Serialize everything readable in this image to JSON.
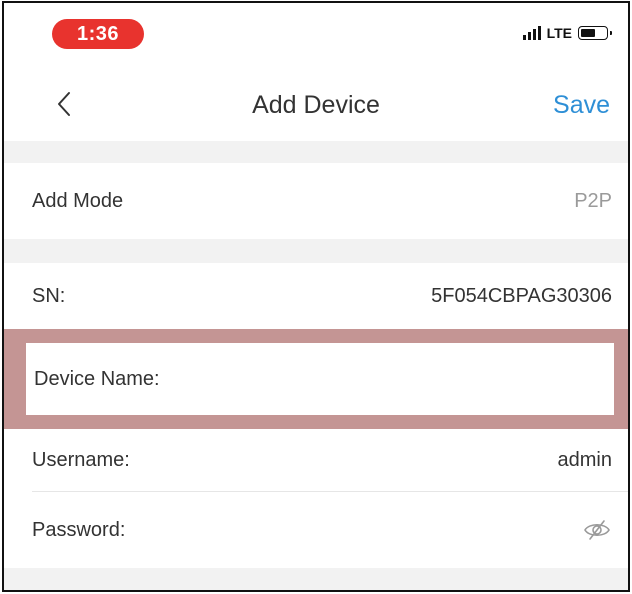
{
  "status_bar": {
    "time": "1:36",
    "network": "LTE"
  },
  "nav": {
    "title": "Add Device",
    "save_label": "Save"
  },
  "form": {
    "add_mode": {
      "label": "Add Mode",
      "value": "P2P"
    },
    "sn": {
      "label": "SN:",
      "value": "5F054CBPAG30306"
    },
    "device_name": {
      "label": "Device Name:",
      "value": ""
    },
    "username": {
      "label": "Username:",
      "value": "admin"
    },
    "password": {
      "label": "Password:",
      "value": ""
    }
  },
  "colors": {
    "accent": "#2e8fd6",
    "time_pill": "#e8332e",
    "highlight": "#c49594",
    "section_gap": "#f2f2f2"
  },
  "icons": [
    "back-chevron-icon",
    "signal-icon",
    "battery-icon",
    "eye-slash-icon"
  ]
}
